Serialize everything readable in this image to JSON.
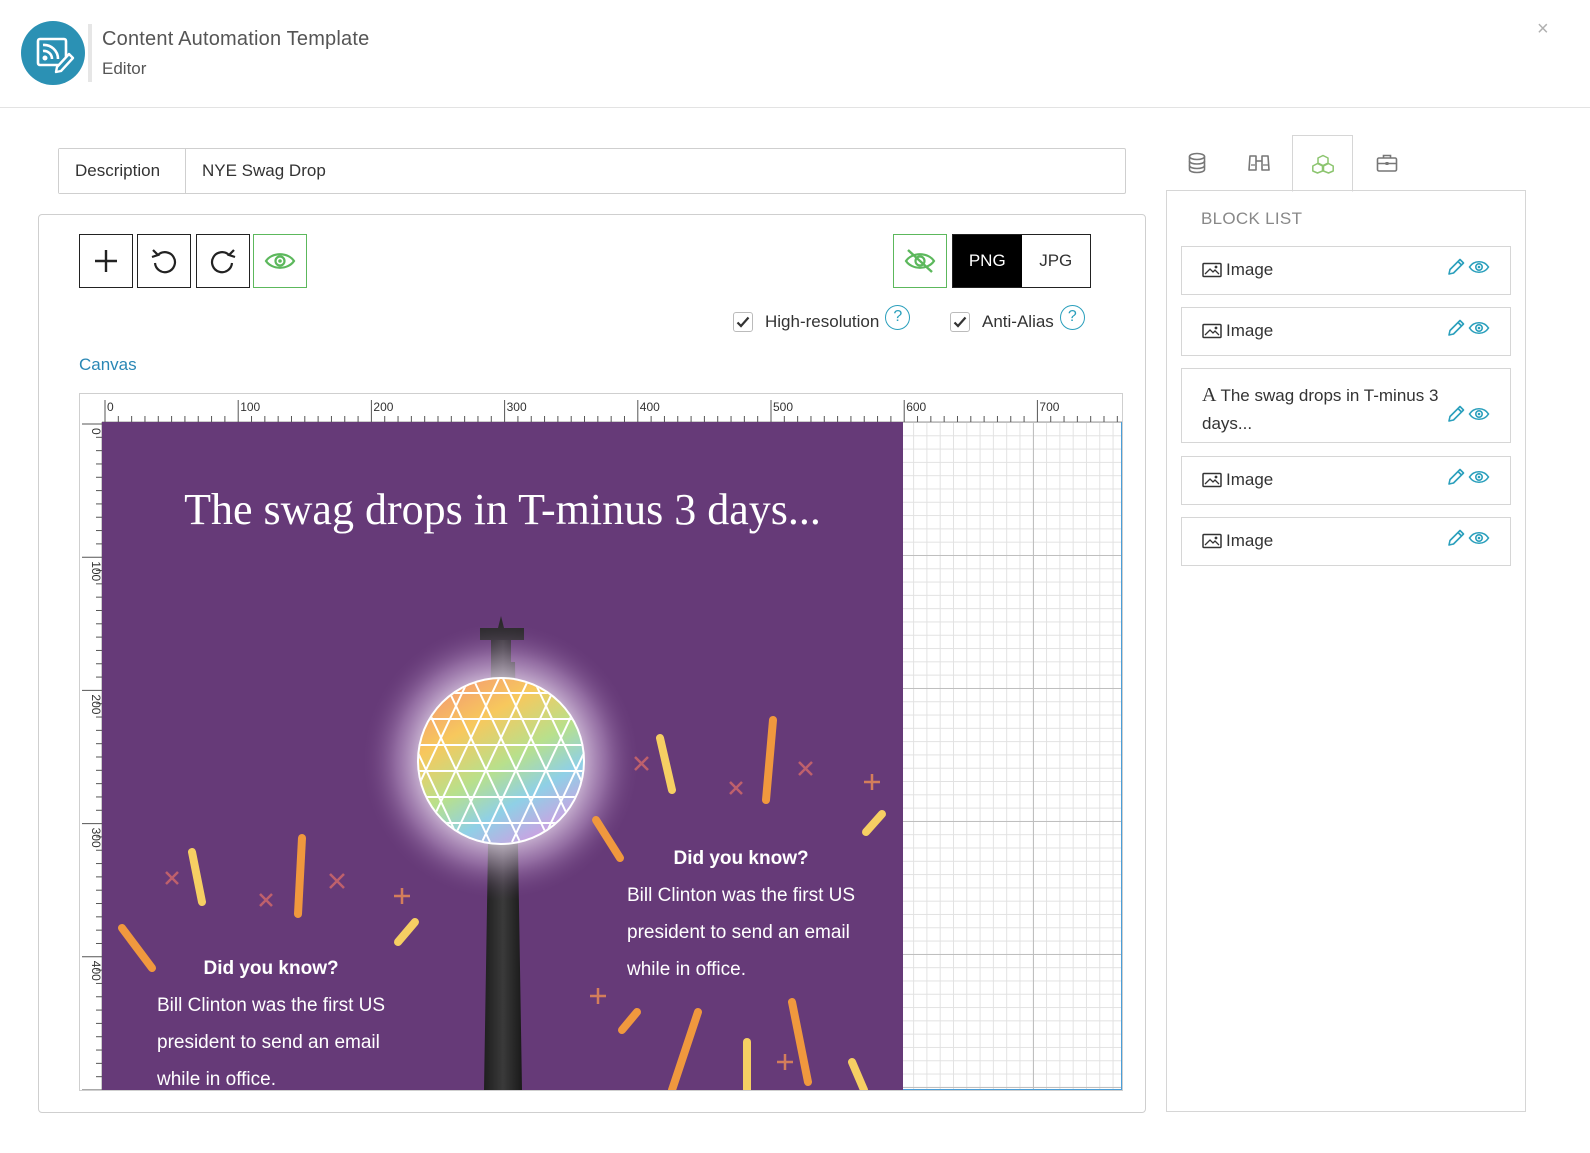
{
  "header": {
    "title": "Content Automation Template",
    "subtitle": "Editor",
    "close": "×"
  },
  "description": {
    "label": "Description",
    "value": "NYE Swag Drop"
  },
  "toolbar": {
    "add": "add",
    "undo": "undo",
    "redo": "redo",
    "preview": "preview"
  },
  "format": {
    "options": [
      "PNG",
      "JPG"
    ],
    "selected": "PNG"
  },
  "options": [
    {
      "label": "High-resolution",
      "checked": true
    },
    {
      "label": "Anti-Alias",
      "checked": true
    }
  ],
  "help": "?",
  "canvas": {
    "label": "Canvas",
    "h_ticks": [
      "0",
      "100",
      "200",
      "300",
      "400",
      "500",
      "600",
      "700"
    ],
    "v_ticks": [
      "0",
      "100",
      "200",
      "300",
      "400"
    ]
  },
  "artwork": {
    "title": "The swag drops in T-minus 3 days...",
    "fact_heading": "Did you know?",
    "fact_text": [
      "Bill Clinton was the first US",
      "president to send an email",
      "while in office."
    ]
  },
  "sidebar": {
    "tabs": [
      "database",
      "binoculars",
      "blocks",
      "briefcase"
    ],
    "active_tab": "blocks",
    "block_list_title": "BLOCK LIST",
    "items": [
      {
        "type": "image",
        "label": "Image"
      },
      {
        "type": "image",
        "label": "Image"
      },
      {
        "type": "text",
        "label": "The swag drops in T-minus 3",
        "label2": "days..."
      },
      {
        "type": "image",
        "label": "Image"
      },
      {
        "type": "image",
        "label": "Image"
      }
    ]
  },
  "colors": {
    "accent": "#2a9fbc",
    "green": "#5cb85c",
    "artwork_bg": "#663a78",
    "logo": "#2b91b4"
  }
}
